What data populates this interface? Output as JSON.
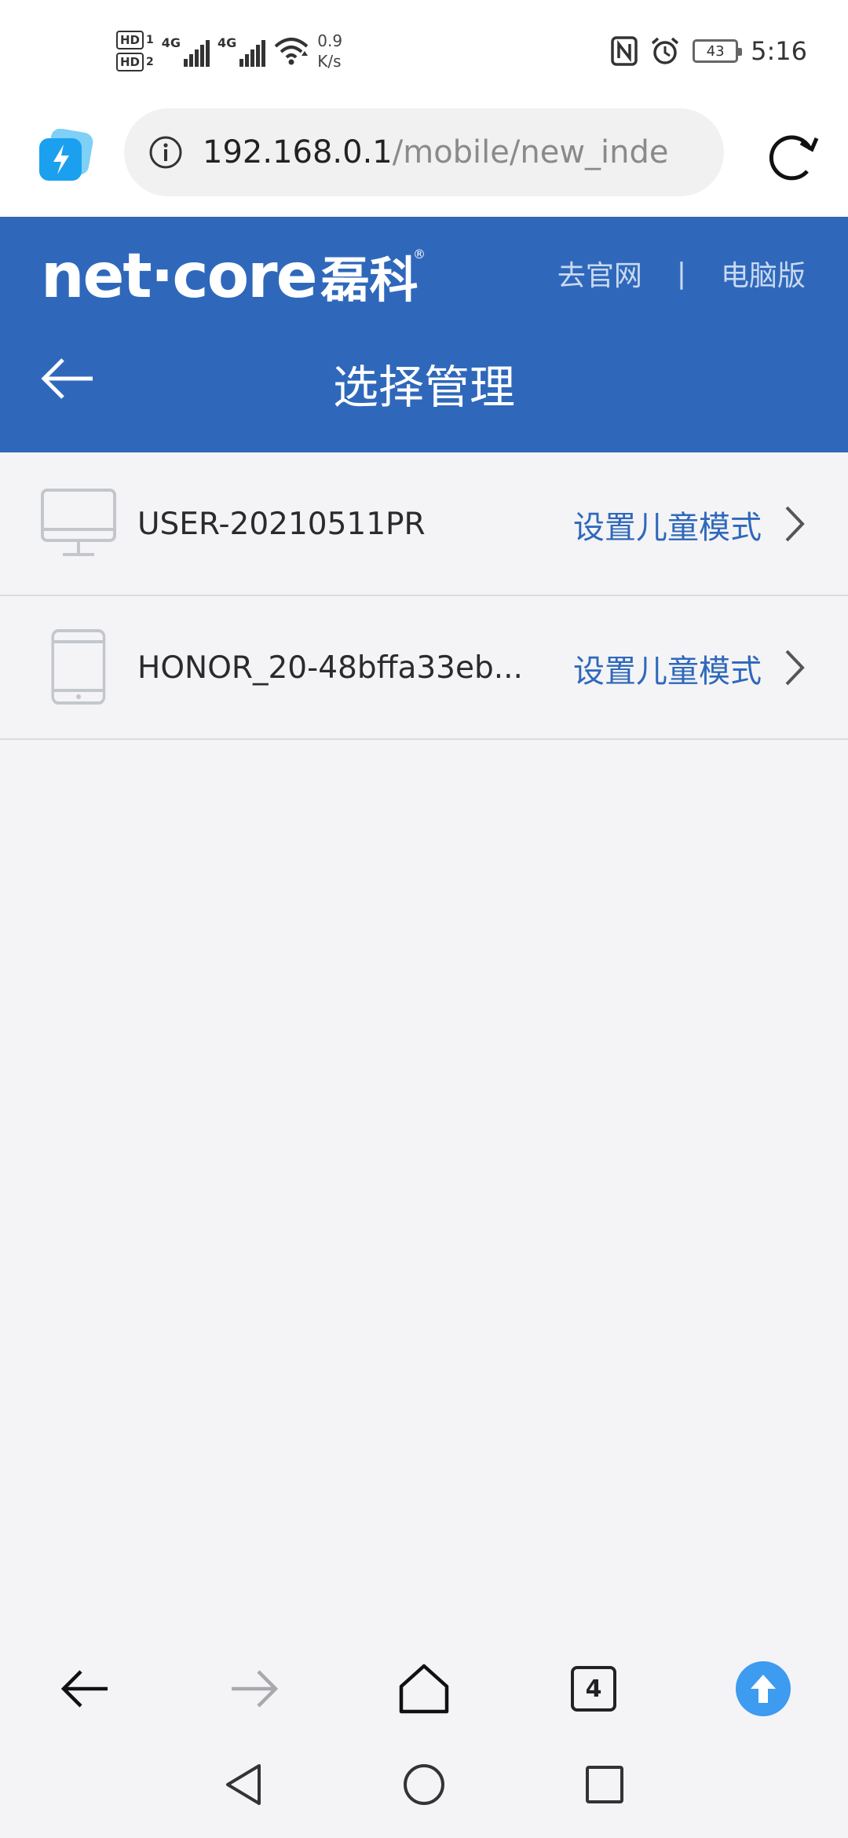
{
  "status_bar": {
    "hd1": "HD",
    "hd1_sub": "1",
    "hd2": "HD",
    "hd2_sub": "2",
    "sig1_label": "4G",
    "sig2_label": "4G",
    "net_speed_value": "0.9",
    "net_speed_unit": "K/s",
    "battery": "43",
    "time": "5:16"
  },
  "browser": {
    "url_host": "192.168.0.1",
    "url_path": "/mobile/new_inde",
    "tab_count": "4"
  },
  "header": {
    "logo_text": "net·core",
    "logo_cn": "磊科",
    "logo_reg": "®",
    "link_official": "去官网",
    "separator": "|",
    "link_desktop": "电脑版",
    "title": "选择管理"
  },
  "devices": [
    {
      "name": "USER-20210511PR",
      "icon": "desktop-monitor-icon",
      "action": "设置儿童模式"
    },
    {
      "name": "HONOR_20-48bffa33eb...",
      "icon": "mobile-phone-icon",
      "action": "设置儿童模式"
    }
  ],
  "colors": {
    "header_blue": "#2f68bb",
    "link_blue": "#2f68bb",
    "upload_blue": "#3d9bf0",
    "page_bg": "#f4f4f6"
  }
}
